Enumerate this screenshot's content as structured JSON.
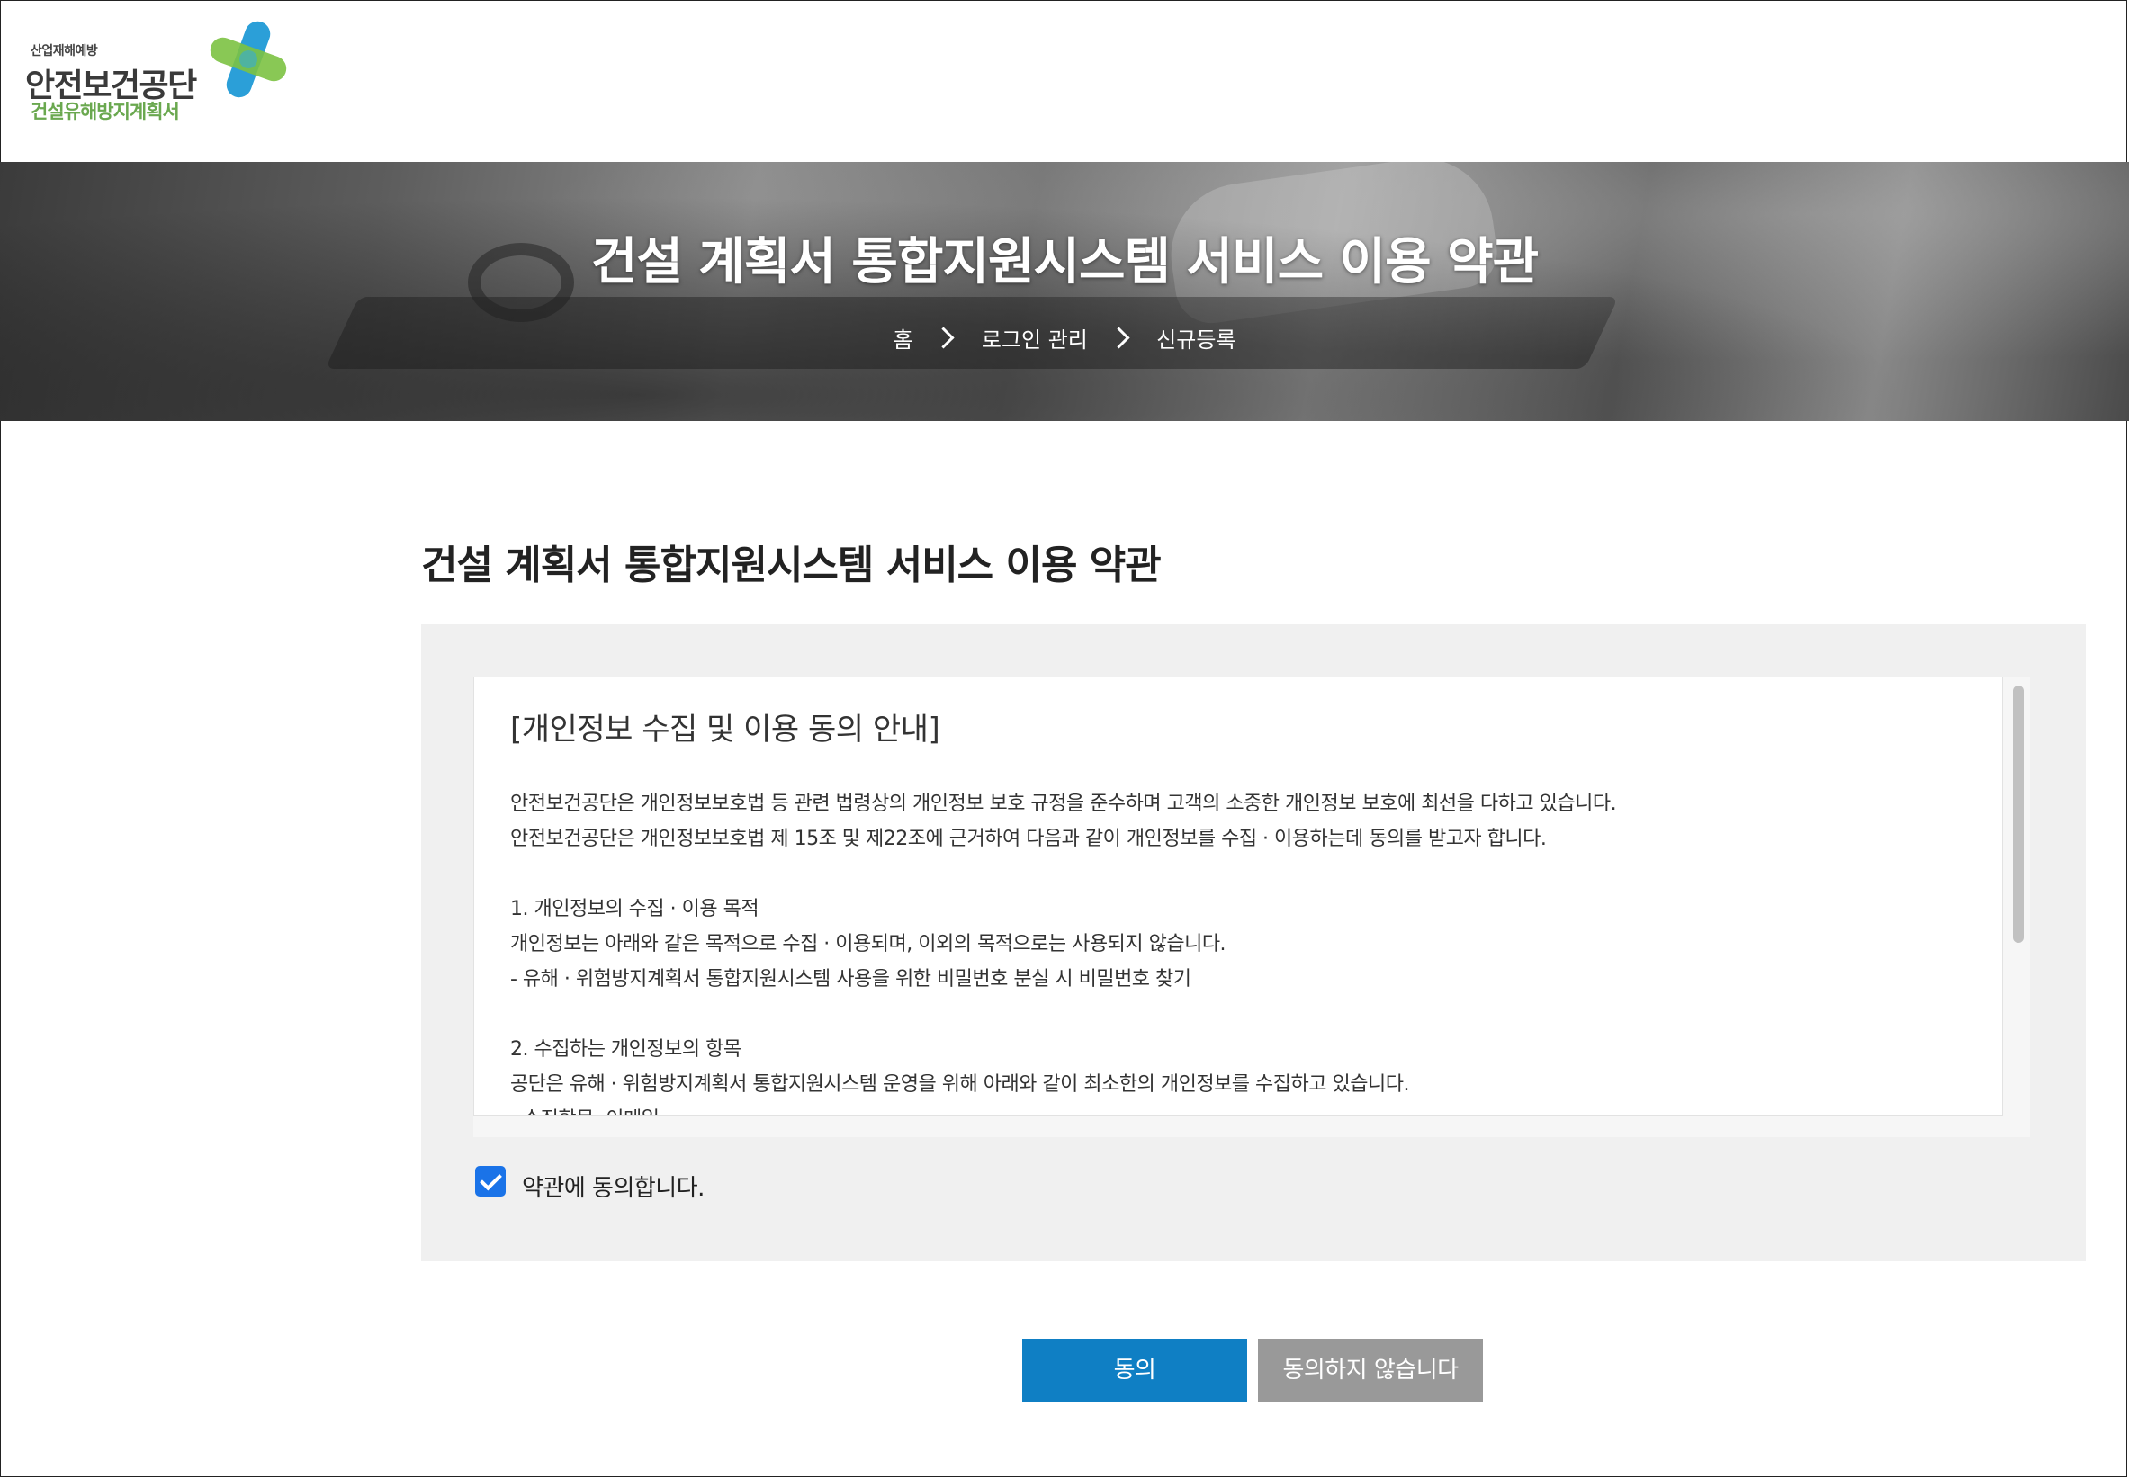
{
  "header": {
    "logo": {
      "tagline": "산업재해예방",
      "name": "안전보건공단",
      "subtitle": "건설유해방지계획서"
    }
  },
  "banner": {
    "title": "건설 계획서 통합지원시스템 서비스 이용 약관",
    "breadcrumb": [
      "홈",
      "로그인 관리",
      "신규등록"
    ]
  },
  "main": {
    "page_title": "건설 계획서 통합지원시스템 서비스 이용 약관",
    "terms": {
      "heading": "[개인정보 수집 및 이용 동의 안내]",
      "lines": [
        "안전보건공단은 개인정보보호법 등 관련 법령상의 개인정보 보호 규정을 준수하며 고객의 소중한 개인정보 보호에 최선을 다하고 있습니다.",
        "안전보건공단은 개인정보보호법 제 15조 및 제22조에 근거하여 다음과 같이 개인정보를 수집 · 이용하는데 동의를 받고자 합니다.",
        "",
        "1. 개인정보의 수집 · 이용 목적",
        "개인정보는 아래와 같은 목적으로 수집 · 이용되며, 이외의 목적으로는 사용되지 않습니다.",
        "  - 유해 · 위험방지계획서 통합지원시스템 사용을 위한 비밀번호 분실 시 비밀번호 찾기",
        "",
        "2. 수집하는 개인정보의 항목",
        "공단은 유해 · 위험방지계획서 통합지원시스템 운영을 위해 아래와 같이 최소한의 개인정보를 수집하고 있습니다.",
        "  - 수집항목: 이메일"
      ]
    },
    "agree_checkbox": {
      "label": "약관에 동의합니다.",
      "checked": true
    }
  },
  "actions": {
    "agree_label": "동의",
    "disagree_label": "동의하지 않습니다"
  },
  "colors": {
    "primary_button": "#0f7fc4",
    "secondary_button": "#999999",
    "panel_bg": "#f0f0f0",
    "checkbox": "#1a73e8",
    "logo_green": "#6aa84f",
    "logo_blue": "#2b9fd8"
  }
}
